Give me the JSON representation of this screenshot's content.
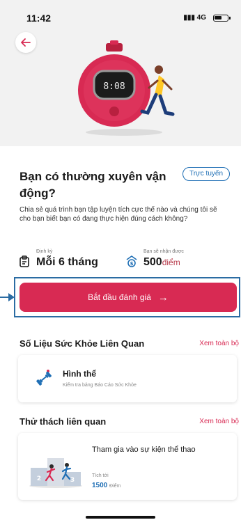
{
  "status_bar": {
    "time": "11:42",
    "network": "4G"
  },
  "question": {
    "title": "Bạn có thường xuyên vận động?",
    "badge": "Trực tuyến",
    "description": "Chia sẻ quá trình bạn tập luyện tích cực thế nào và chúng tôi sẽ cho bạn biết bạn có đang thực hiện đúng cách không?"
  },
  "stats": {
    "frequency": {
      "label": "Định kỳ",
      "value": "Mỗi 6 tháng"
    },
    "reward": {
      "label": "Bạn sẽ nhận được",
      "value": "500",
      "unit": "điểm"
    }
  },
  "cta": {
    "label": "Bắt đầu đánh giá",
    "arrow": "→"
  },
  "health_section": {
    "title": "Số Liệu Sức Khỏe Liên Quan",
    "see_all": "Xem toàn bộ",
    "card": {
      "title": "Hình thể",
      "subtitle": "Kiểm tra bảng Báo Cáo Sức Khỏe"
    }
  },
  "challenge_section": {
    "title": "Thử thách liên quan",
    "see_all": "Xem toàn bộ",
    "card": {
      "title": "Tham gia vào sự kiện thể thao",
      "earn_label": "Tích tới",
      "points": "1500",
      "points_unit": "Điểm"
    }
  },
  "colors": {
    "accent": "#d82a53",
    "blue": "#1f6fb5",
    "hero_bg": "#f2f2f2"
  },
  "icons": [
    "back-arrow-icon",
    "calendar-icon",
    "reward-icon",
    "dumbbell-icon",
    "podium-icon",
    "arrow-right-icon"
  ]
}
